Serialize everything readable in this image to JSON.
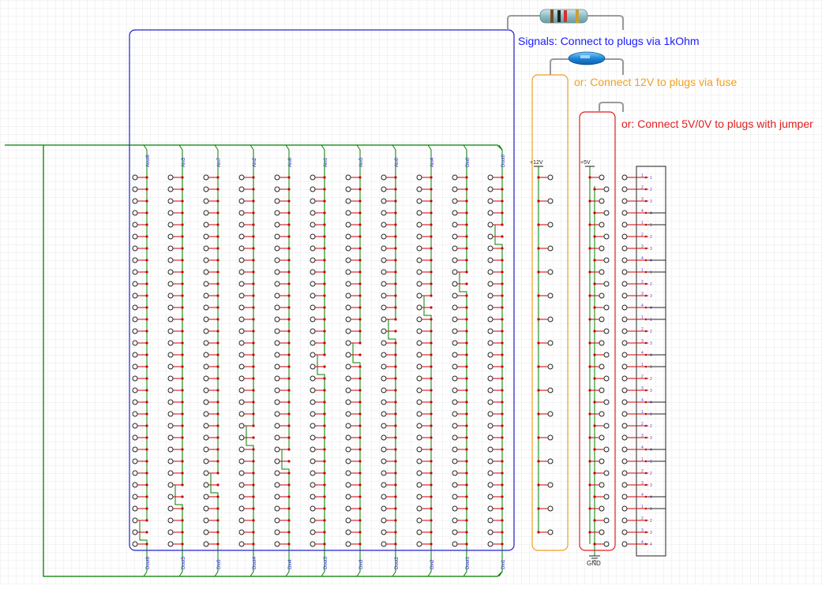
{
  "notes": {
    "signals": "Signals: Connect to plugs via 1kOhm",
    "fuse": "or: Connect 12V to plugs via fuse",
    "jumper": "or: Connect 5V/0V to plugs with jumper"
  },
  "colors": {
    "background": "#ffffff",
    "grid": "#e8e8e8",
    "wire": "#008000",
    "pin": "#cc0000",
    "signals_box": "#2222cc",
    "fuse_box": "#f0a020",
    "jumper_box": "#e02020",
    "connector_label": "#6633cc"
  },
  "columns": {
    "top_labels": [
      "Aout6",
      "Ain3",
      "Ain7",
      "Ain2",
      "Ain6",
      "Ain1",
      "Ain5",
      "Ain0",
      "Ain4",
      "Din0",
      "Dout0"
    ],
    "bottom_labels": [
      "Dout6",
      "Dout5",
      "Din5",
      "Dout4",
      "Din4",
      "Dout3",
      "Din3",
      "Dout2",
      "Din2",
      "Dout1",
      "Din1"
    ]
  },
  "rails": {
    "v12": "+12V",
    "v5": "+5V",
    "gnd": "GND"
  },
  "connector": {
    "pin_numbers": [
      "1",
      "2",
      "3",
      "4"
    ]
  }
}
